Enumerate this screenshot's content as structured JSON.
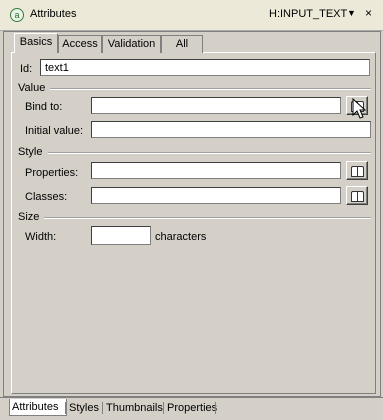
{
  "titlebar": {
    "app_icon": "a",
    "title": "Attributes",
    "mode": "H:INPUT_TEXT",
    "dropdown_icon": "▼",
    "close_icon": "×"
  },
  "tabs": [
    {
      "label": "Basics",
      "active": true
    },
    {
      "label": "Access"
    },
    {
      "label": "Validation"
    },
    {
      "label": "All"
    }
  ],
  "form": {
    "id_label": "Id:",
    "id_value": "text1",
    "value_section": "Value",
    "bind_label": "Bind to:",
    "bind_value": "",
    "initial_label": "Initial value:",
    "initial_value": "",
    "style_section": "Style",
    "properties_label": "Properties:",
    "properties_value": "",
    "classes_label": "Classes:",
    "classes_value": "",
    "size_section": "Size",
    "width_label": "Width:",
    "width_value": "",
    "width_unit": "characters"
  },
  "icons": {
    "browse": "book-icon"
  },
  "bottom_tabs": [
    {
      "label": "Attributes",
      "active": true
    },
    {
      "label": "Styles"
    },
    {
      "label": "Thumbnails"
    },
    {
      "label": "Properties"
    }
  ]
}
